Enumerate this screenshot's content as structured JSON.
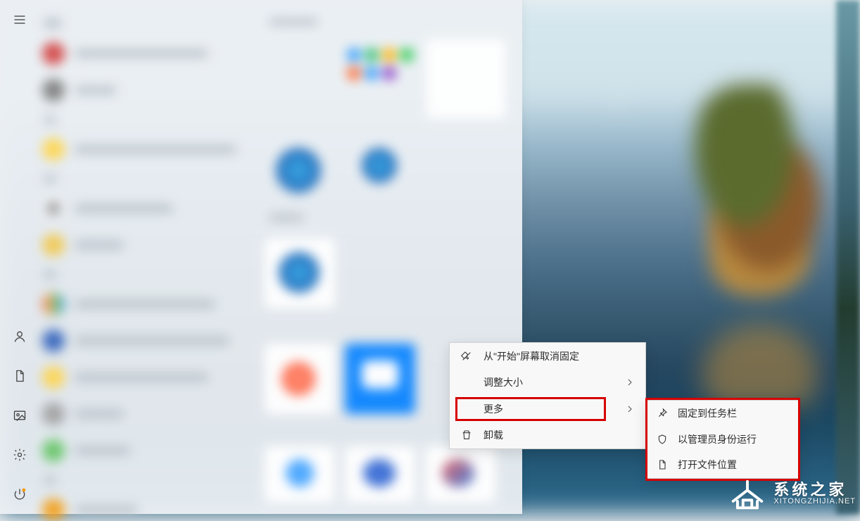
{
  "left_strip": {
    "items": [
      {
        "name": "hamburger-icon"
      },
      {
        "name": "user-icon"
      },
      {
        "name": "document-icon"
      },
      {
        "name": "picture-icon"
      },
      {
        "name": "settings-icon"
      },
      {
        "name": "power-icon"
      }
    ]
  },
  "context_menu": {
    "unpin": {
      "label": "从\"开始\"屏幕取消固定"
    },
    "resize": {
      "label": "调整大小"
    },
    "more": {
      "label": "更多"
    },
    "uninstall": {
      "label": "卸载"
    }
  },
  "submenu": {
    "pin_taskbar": {
      "label": "固定到任务栏"
    },
    "admin": {
      "label": "以管理员身份运行"
    },
    "open_loc": {
      "label": "打开文件位置"
    }
  },
  "watermark": {
    "title": "系统之家",
    "url": "XITONGZHIJIA.NET"
  },
  "annotation_color": "#d60000"
}
